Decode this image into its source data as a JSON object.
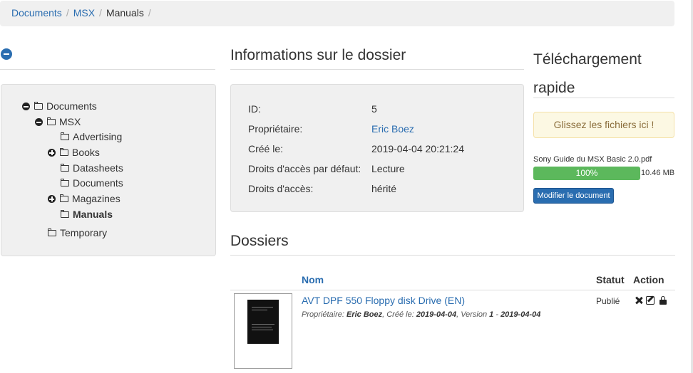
{
  "breadcrumb": {
    "items": [
      {
        "label": "Documents"
      },
      {
        "label": "MSX"
      }
    ],
    "current": "Manuals",
    "separator": "/"
  },
  "tree": {
    "nodes": [
      {
        "label": "Documents",
        "toggle": "collapse"
      },
      {
        "label": "MSX",
        "toggle": "collapse"
      },
      {
        "label": "Advertising",
        "toggle": "none"
      },
      {
        "label": "Books",
        "toggle": "expand"
      },
      {
        "label": "Datasheets",
        "toggle": "none"
      },
      {
        "label": "Documents",
        "toggle": "none"
      },
      {
        "label": "Magazines",
        "toggle": "expand"
      },
      {
        "label": "Manuals",
        "toggle": "none",
        "selected": true
      },
      {
        "label": "Temporary",
        "toggle": "none"
      }
    ]
  },
  "folder_info": {
    "title": "Informations sur le dossier",
    "rows": [
      {
        "label": "ID:",
        "value": "5"
      },
      {
        "label": "Propriétaire:",
        "value": "Eric Boez"
      },
      {
        "label": "Créé le:",
        "value": "2019-04-04 20:21:24"
      },
      {
        "label": "Droits d'accès par défaut:",
        "value": "Lecture"
      },
      {
        "label": "Droits d'accès:",
        "value": "hérité"
      }
    ]
  },
  "quick_upload": {
    "title": "Téléchargement rapide",
    "drop_text": "Glissez les fichiers ici !",
    "file_name": "Sony Guide du MSX Basic 2.0.pdf",
    "progress": 100,
    "progress_label": "100%",
    "file_size": "10.46 MB",
    "button_label": "Modifier le document"
  },
  "folders": {
    "title": "Dossiers",
    "columns": {
      "name": "Nom",
      "status": "Statut",
      "action": "Action"
    },
    "rows": [
      {
        "title": "AVT DPF 550 Floppy disk Drive (EN)",
        "meta_owner_label": "Propriétaire: ",
        "meta_owner": "Eric Boez",
        "meta_created_label": ", Créé le: ",
        "meta_created": "2019-04-04",
        "meta_version_label": ", Version ",
        "meta_version": "1",
        "meta_sep": " - ",
        "meta_version_date": "2019-04-04",
        "status": "Publié",
        "actions": [
          "delete-icon",
          "edit-icon",
          "lock-icon"
        ]
      }
    ]
  },
  "colors": {
    "link": "#2a6db0",
    "progress": "#5cb85c",
    "warning_bg": "#fcf8e3",
    "warning_text": "#8a6d3b"
  }
}
